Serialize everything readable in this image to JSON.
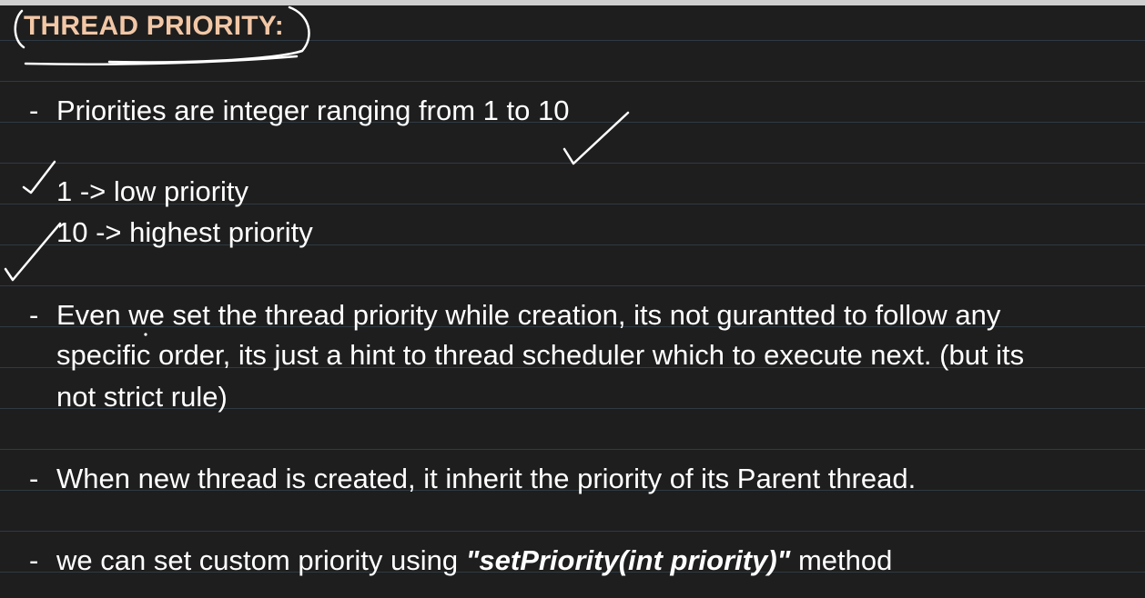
{
  "title": "THREAD PRIORITY:",
  "bullets": {
    "b1": "Priorities are integer ranging from 1 to 10",
    "low": "1 -> low priority",
    "high": "10 -> highest priority",
    "b2_line1": "Even we set the thread priority while creation, its not gurantted to follow any",
    "b2_line2": "specific order, its just a hint to thread scheduler which to execute next. (but its",
    "b2_line3": "not strict rule)",
    "b3": "When new thread is created, it inherit the priority of its Parent thread.",
    "b4_pre": "we can set custom priority using ",
    "b4_code": "\"setPriority(int priority)\"",
    "b4_post": " method"
  },
  "dash_glyph": "-",
  "colors": {
    "background": "#1e1e1e",
    "ruled_line": "#2f3a42",
    "title": "#f2c7a6",
    "text": "#ffffff",
    "ink": "#ffffff"
  },
  "annotations": [
    "check-mark-icon",
    "check-mark-icon",
    "check-mark-icon",
    "title-ellipse-icon",
    "title-underline-icon"
  ]
}
